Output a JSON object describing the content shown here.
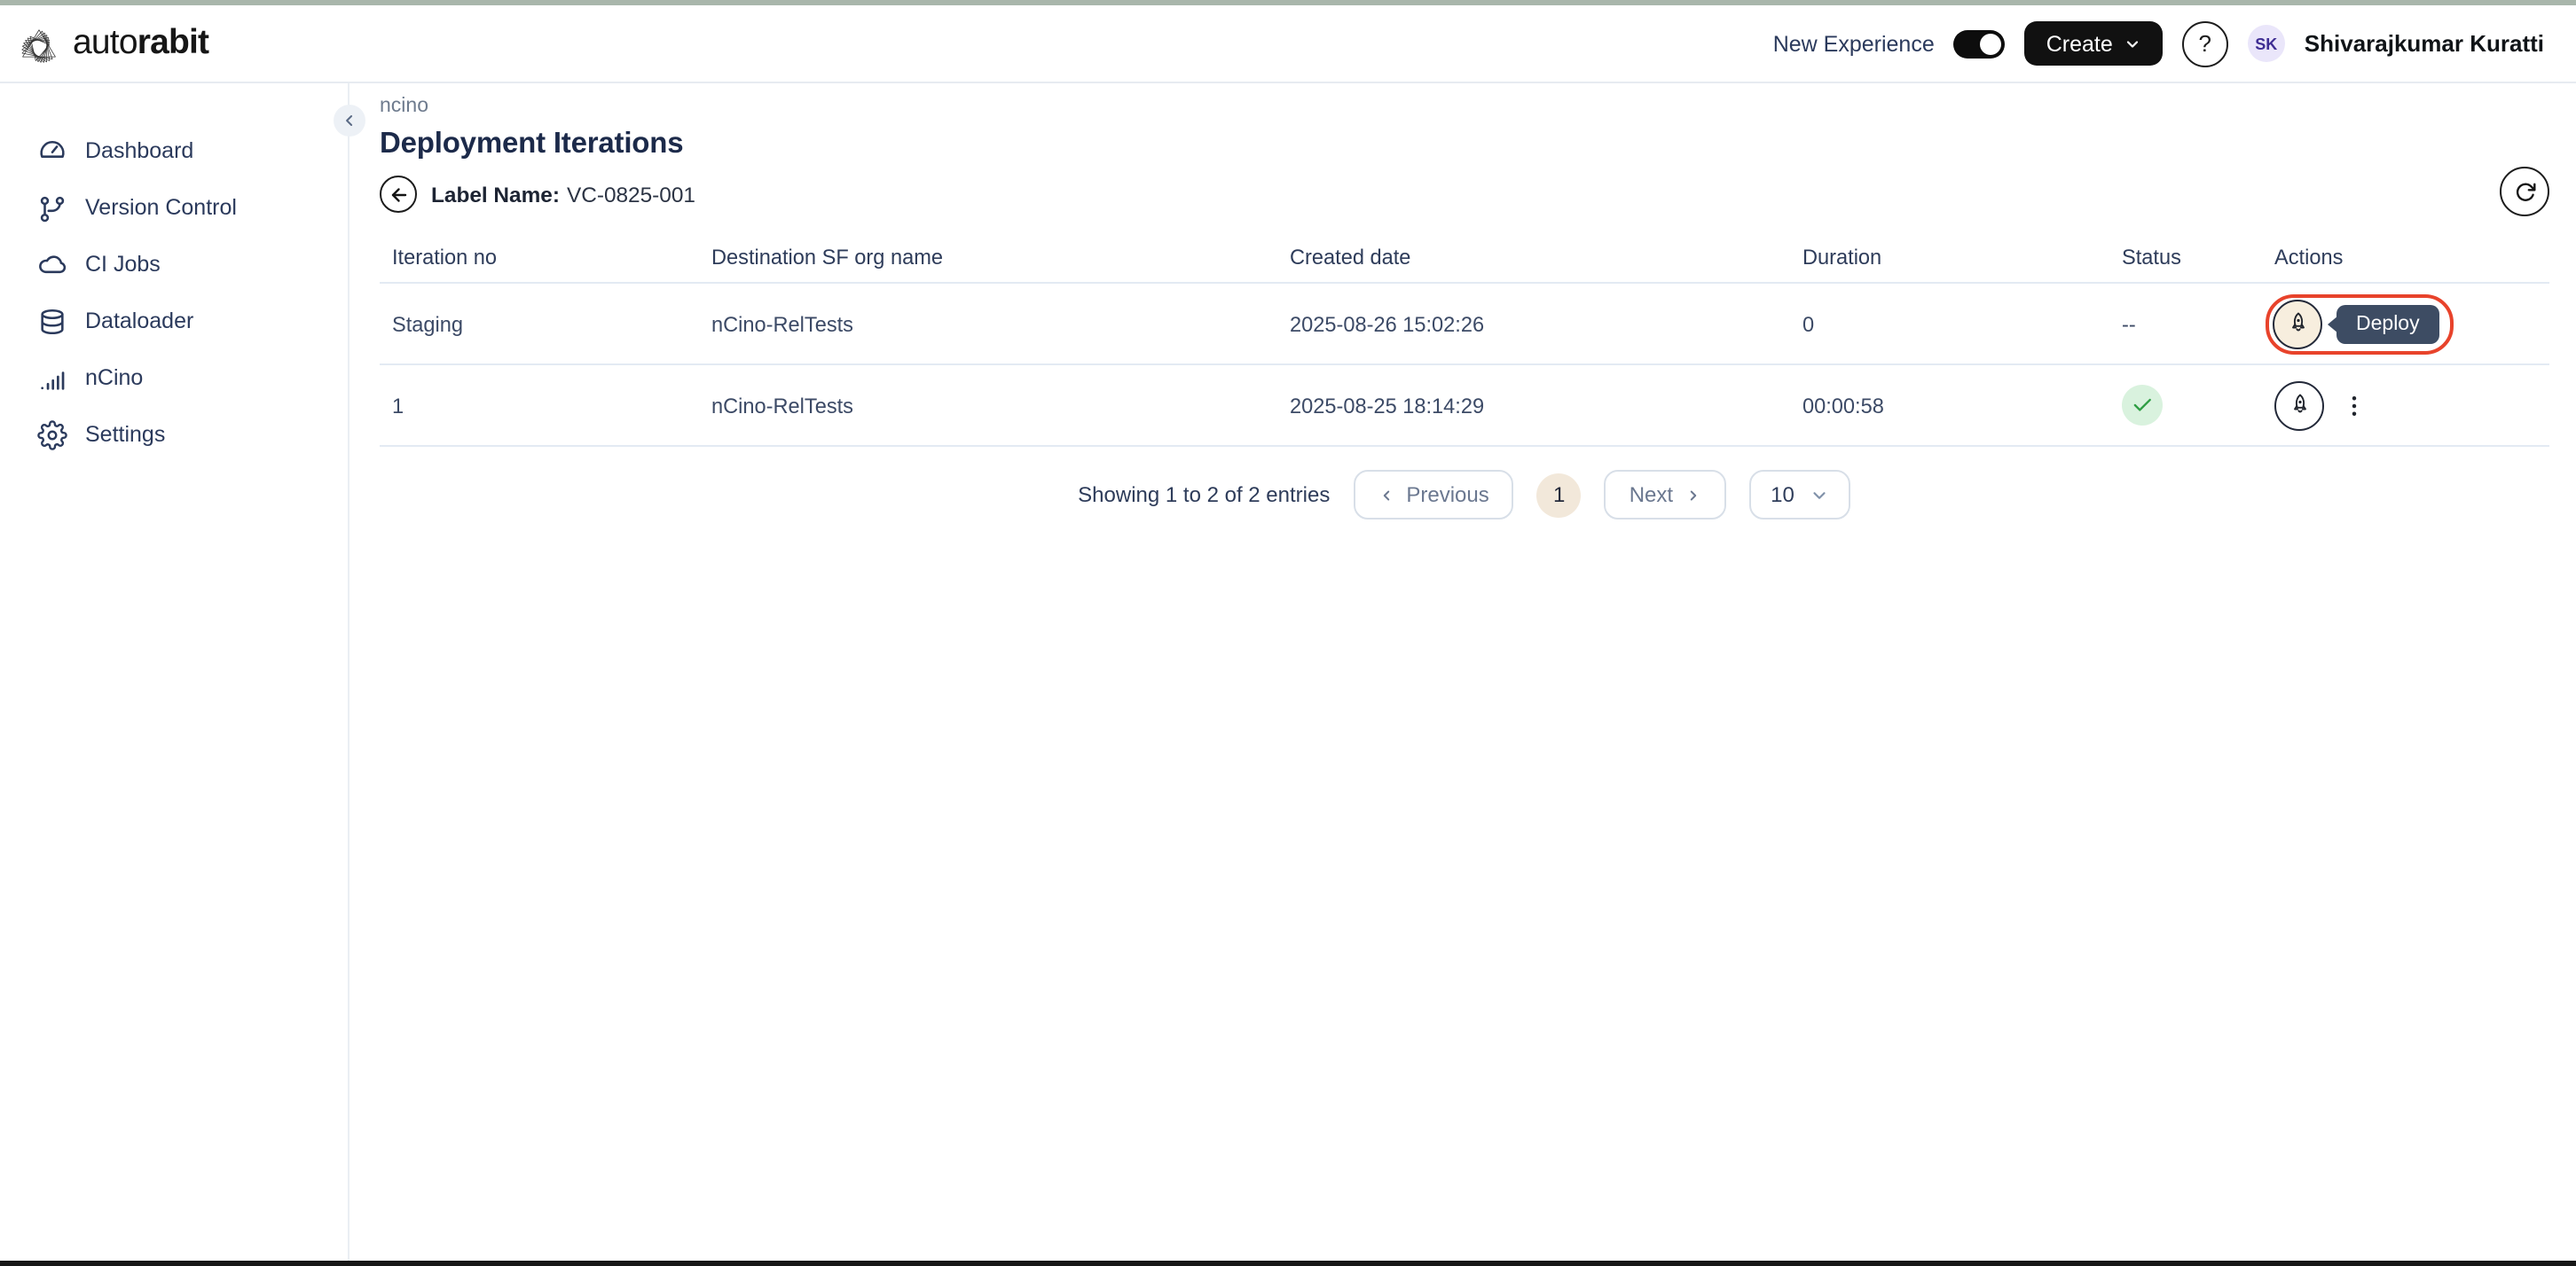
{
  "window": {
    "top_edge_color": "#a9b6ab",
    "bottom_edge_color": "#171717"
  },
  "header": {
    "brand": {
      "name_regular": "auto",
      "name_bold": "rabit"
    },
    "new_experience_label": "New Experience",
    "new_experience_toggle": "on",
    "create_button": {
      "label": "Create"
    },
    "help_glyph": "?",
    "user": {
      "initials": "SK",
      "name": "Shivarajkumar Kuratti"
    }
  },
  "sidebar": {
    "items": [
      {
        "label": "Dashboard",
        "icon": "gauge"
      },
      {
        "label": "Version Control",
        "icon": "git-branch"
      },
      {
        "label": "CI Jobs",
        "icon": "cloud"
      },
      {
        "label": "Dataloader",
        "icon": "database"
      },
      {
        "label": "nCino",
        "icon": "bar-chart"
      },
      {
        "label": "Settings",
        "icon": "gear"
      }
    ]
  },
  "main": {
    "breadcrumb": "ncino",
    "page_title": "Deployment Iterations",
    "label_name": {
      "label": "Label Name:",
      "value": "VC-0825-001"
    },
    "table": {
      "columns": [
        "Iteration no",
        "Destination SF org name",
        "Created date",
        "Duration",
        "Status",
        "Actions"
      ],
      "rows": [
        {
          "iteration_no": "Staging",
          "destination_org": "nCino-RelTests",
          "created_date": "2025-08-26 15:02:26",
          "duration": "0",
          "status_text": "--",
          "status_type": "none",
          "deploy_tooltip": "Deploy",
          "highlighted": true
        },
        {
          "iteration_no": "1",
          "destination_org": "nCino-RelTests",
          "created_date": "2025-08-25 18:14:29",
          "duration": "00:00:58",
          "status_text": "",
          "status_type": "success",
          "highlighted": false
        }
      ]
    },
    "pagination": {
      "summary": "Showing 1 to 2 of 2 entries",
      "previous_label": "Previous",
      "current_page": "1",
      "next_label": "Next",
      "page_size": "10"
    }
  },
  "colors": {
    "accent_red_highlight": "#e8432b",
    "tooltip_bg": "#3d4c63",
    "success_bg": "#d9f2de",
    "success_check": "#2f9e44",
    "cream_button_bg": "#f7eede",
    "avatar_bg": "#eae6fa",
    "avatar_text": "#3f2e93",
    "primary_button_bg": "#111111",
    "navy_text": "#2b3a5c"
  }
}
